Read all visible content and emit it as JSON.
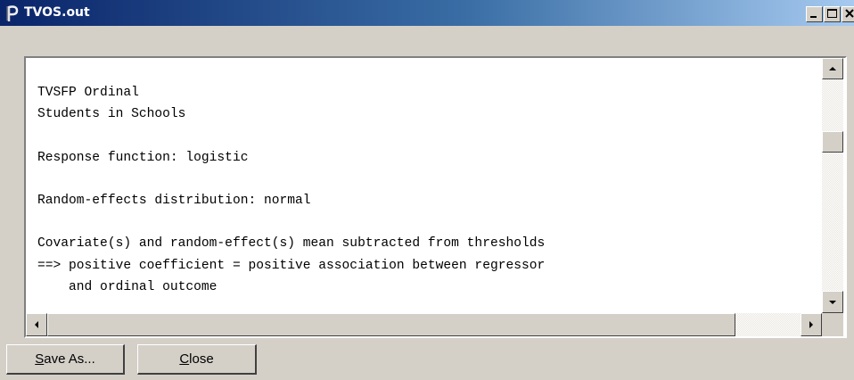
{
  "window": {
    "title": "TVOS.out",
    "icon": "app-pipe-icon",
    "controls": [
      "minimize-icon",
      "maximize-icon",
      "close-icon"
    ]
  },
  "output_text": {
    "lines": [
      "TVSFP Ordinal",
      "Students in Schools",
      "",
      "Response function: logistic",
      "",
      "Random-effects distribution: normal",
      "",
      "Covariate(s) and random-effect(s) mean subtracted from thresholds",
      "==> positive coefficient = positive association between regressor",
      "    and ordinal outcome"
    ]
  },
  "buttons": {
    "save_as": {
      "mnemonic": "S",
      "rest": "ave As..."
    },
    "close": {
      "mnemonic": "C",
      "rest": "lose"
    }
  },
  "scrollbars": {
    "vertical_position": 0.27,
    "horizontal_position": 0.0
  }
}
